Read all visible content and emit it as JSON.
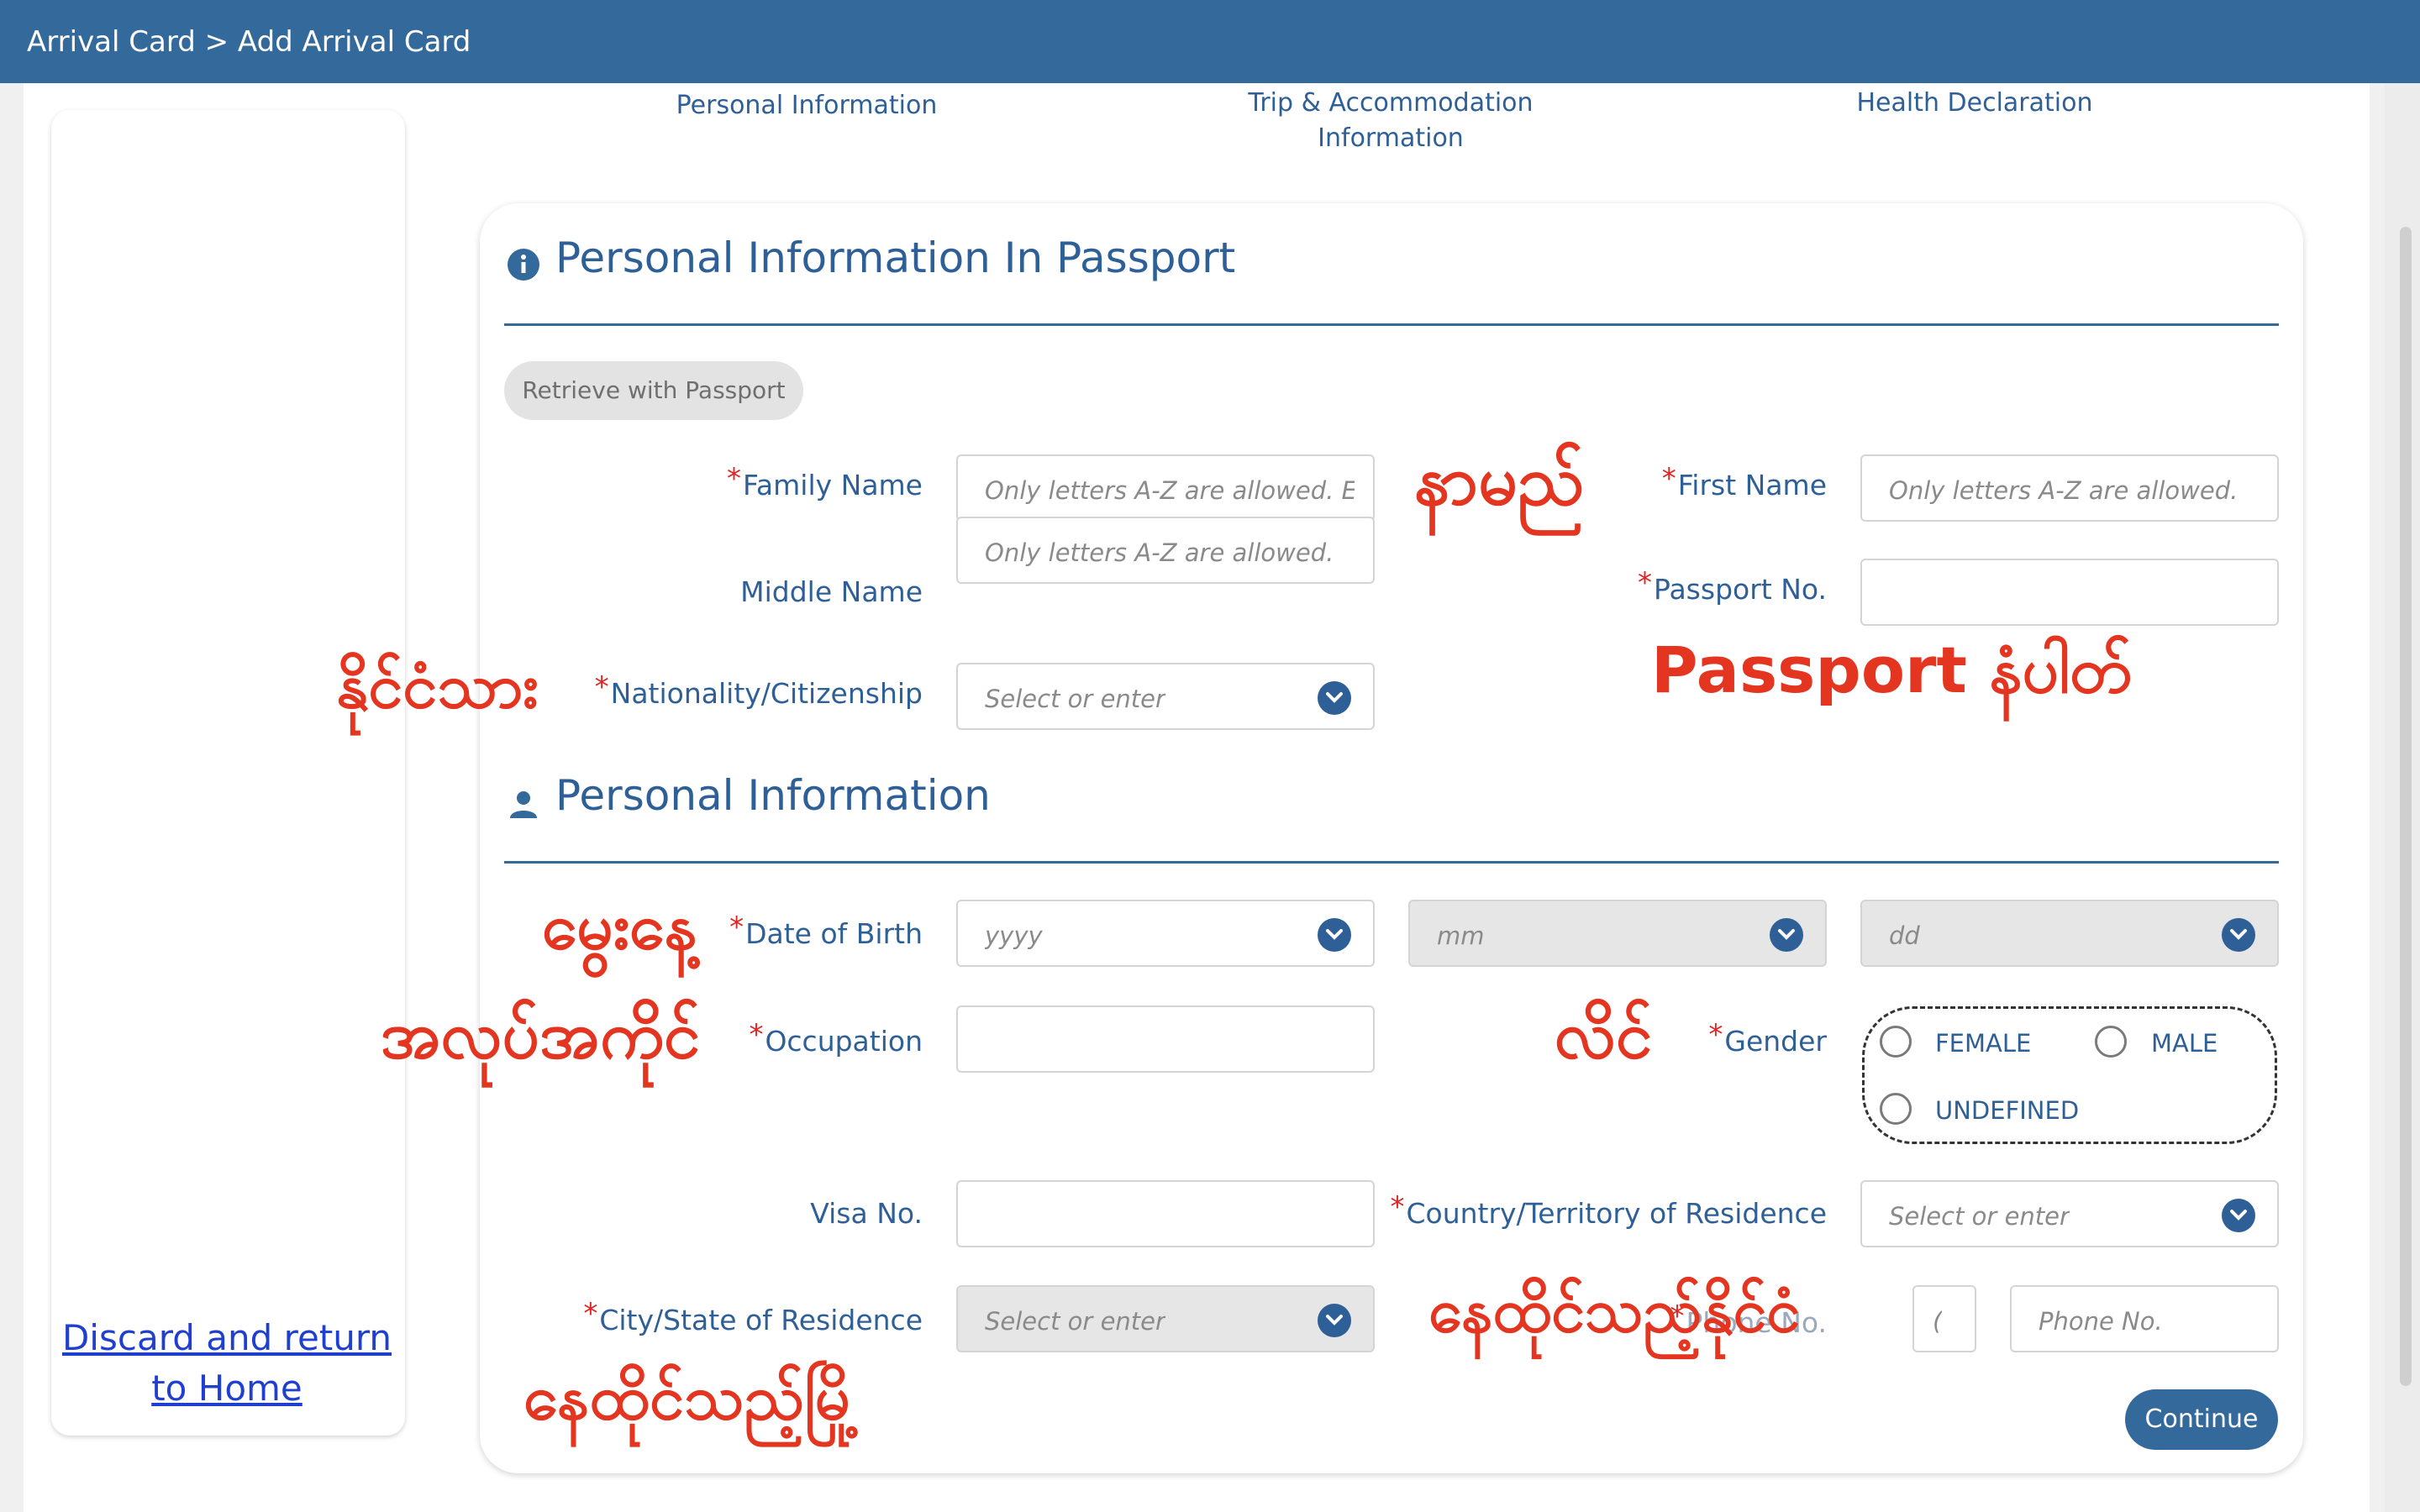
{
  "header": {
    "breadcrumb": "Arrival Card > Add Arrival Card"
  },
  "steps": {
    "step1": "Personal Information",
    "step2_line1": "Trip & Accommodation",
    "step2_line2": "Information",
    "step3": "Health Declaration"
  },
  "sidebar": {
    "discard_line1": "Discard and return",
    "discard_line2": "to Home"
  },
  "passport_section": {
    "title": "Personal Information In Passport",
    "retrieve_button": "Retrieve with Passport",
    "family_name": {
      "label": "Family Name",
      "placeholder": "Only letters A-Z are allowed. Er"
    },
    "first_name": {
      "label": "First Name",
      "placeholder": "Only letters A-Z are allowed."
    },
    "middle_name": {
      "label": "Middle Name",
      "placeholder": "Only letters A-Z are allowed."
    },
    "passport_no": {
      "label": "Passport No.",
      "value": ""
    },
    "nationality": {
      "label": "Nationality/Citizenship",
      "placeholder": "Select or enter"
    }
  },
  "personal_section": {
    "title": "Personal Information",
    "date_of_birth": {
      "label": "Date of Birth",
      "year_placeholder": "yyyy",
      "month_placeholder": "mm",
      "day_placeholder": "dd"
    },
    "occupation": {
      "label": "Occupation",
      "value": ""
    },
    "gender": {
      "label": "Gender",
      "options": [
        "FEMALE",
        "MALE",
        "UNDEFINED"
      ]
    },
    "visa_no": {
      "label": "Visa No.",
      "value": ""
    },
    "country_of_residence": {
      "label": "Country/Territory of Residence",
      "placeholder": "Select or enter"
    },
    "city_of_residence": {
      "label": "City/State of Residence",
      "placeholder": "Select or enter"
    },
    "phone": {
      "label": "Phone No.",
      "code_placeholder": "(",
      "number_placeholder": "Phone No."
    }
  },
  "continue_button": "Continue",
  "annotations": {
    "name": "နာမည်",
    "nationality": "နိုင်ငံသား",
    "passport": "Passport နံပါတ်",
    "birthday": "မွေးနေ့",
    "occupation": "အလုပ်အကိုင်",
    "gender": "လိင်",
    "residence_country": "နေထိုင်သည့်နိုင်ငံ",
    "residence_city": "နေထိုင်သည့်မြို့"
  },
  "colors": {
    "header": "#34699c",
    "label": "#2e5f96",
    "required": "#e02424",
    "annotation": "#e43521"
  }
}
